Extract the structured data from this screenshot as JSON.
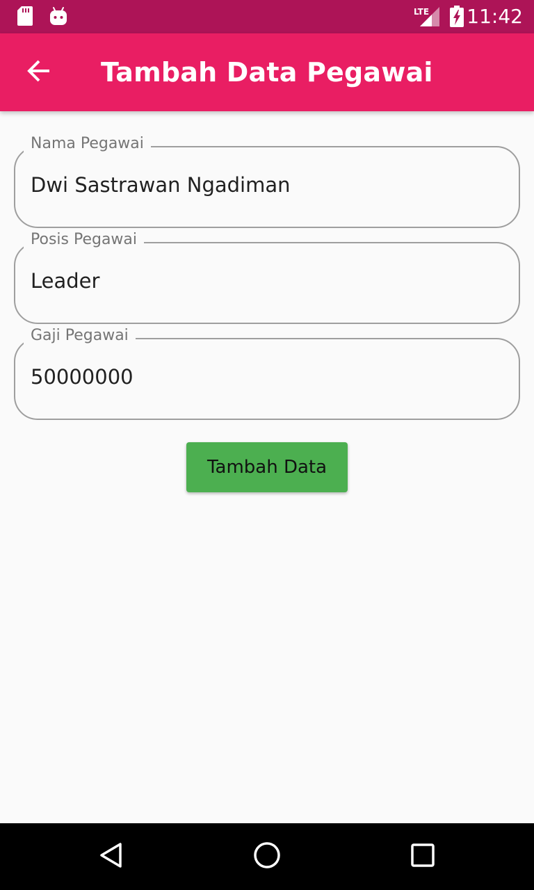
{
  "status_bar": {
    "time": "11:42",
    "network": "LTE",
    "left_icons": [
      "sd-card-icon",
      "android-icon"
    ],
    "right_icons": [
      "lte-signal-icon",
      "battery-charging-icon"
    ]
  },
  "app_bar": {
    "title": "Tambah Data Pegawai",
    "back_icon": "arrow-back-icon"
  },
  "form": {
    "nama": {
      "label": "Nama Pegawai",
      "value": "Dwi Sastrawan Ngadiman"
    },
    "posisi": {
      "label": "Posis Pegawai",
      "value": "Leader"
    },
    "gaji": {
      "label": "Gaji Pegawai",
      "value": "50000000"
    }
  },
  "submit_button": {
    "label": "Tambah Data"
  },
  "nav_bar": {
    "buttons": [
      "back-triangle-icon",
      "home-circle-icon",
      "recents-square-icon"
    ]
  },
  "colors": {
    "status_bar": "#ad1457",
    "app_bar": "#e91e63",
    "button": "#4caf50",
    "field_border": "#9e9e9e",
    "background": "#fafafa"
  }
}
